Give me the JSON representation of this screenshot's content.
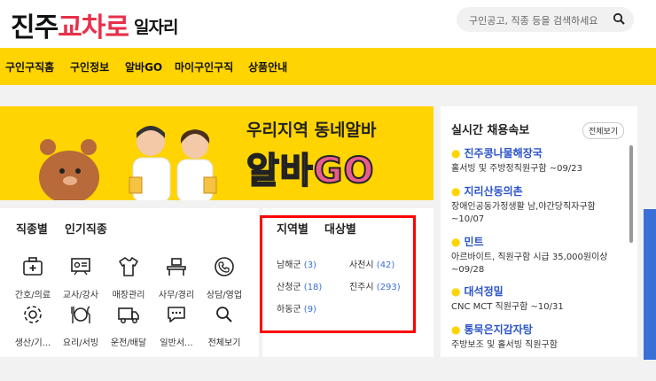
{
  "header": {
    "logo_part1": "진주",
    "logo_part2": "교차로",
    "logo_part3": "일자리",
    "search_placeholder": "구인공고, 직종 등을 검색하세요",
    "search_icon": "search-icon"
  },
  "nav": {
    "items": [
      {
        "label": "구인구직홈",
        "active": true
      },
      {
        "label": "구인정보",
        "active": false
      },
      {
        "label": "알바GO",
        "active": false
      },
      {
        "label": "마이구인구직",
        "active": false
      },
      {
        "label": "상품안내",
        "active": false
      }
    ]
  },
  "banner": {
    "line1": "우리지역 동네알바",
    "line2_a": "알바",
    "line2_b": "GO"
  },
  "categories": {
    "tabs": [
      {
        "label": "직종별",
        "active": true
      },
      {
        "label": "인기직종",
        "active": false
      }
    ],
    "items": [
      {
        "label": "간호/의료",
        "icon": "medical-kit-icon"
      },
      {
        "label": "교사/강사",
        "icon": "teacher-board-icon"
      },
      {
        "label": "매장관리",
        "icon": "shirt-icon"
      },
      {
        "label": "사무/경리",
        "icon": "office-desk-icon"
      },
      {
        "label": "상담/영업",
        "icon": "phone-icon"
      },
      {
        "label": "생산/기...",
        "icon": "gear-icon"
      },
      {
        "label": "요리/서빙",
        "icon": "dish-icon"
      },
      {
        "label": "운전/배달",
        "icon": "truck-icon"
      },
      {
        "label": "일반서...",
        "icon": "chat-bubble-icon"
      },
      {
        "label": "전체보기",
        "icon": "search-icon"
      }
    ]
  },
  "regions": {
    "tabs": [
      {
        "label": "지역별",
        "active": true
      },
      {
        "label": "대상별",
        "active": false
      }
    ],
    "items": [
      {
        "name": "남해군",
        "count": "(3)"
      },
      {
        "name": "사천시",
        "count": "(42)"
      },
      {
        "name": "산청군",
        "count": "(18)"
      },
      {
        "name": "진주시",
        "count": "(293)"
      },
      {
        "name": "하동군",
        "count": "(9)"
      }
    ]
  },
  "live": {
    "title": "실시간 채용속보",
    "view_all": "전체보기",
    "posts": [
      {
        "name": "진주콩나물해장국",
        "desc": "홀서빙 및 주방정직원구함 ~09/23"
      },
      {
        "name": "지리산동의촌",
        "desc": "장애인공동가정생활 남,야간당직자구함 ~10/07"
      },
      {
        "name": "민트",
        "desc": "아르바이트, 직원구함 시급 35,000원이상 ~09/28"
      },
      {
        "name": "대석정밀",
        "desc": "CNC MCT 직원구함 ~10/31"
      },
      {
        "name": "통묵은지감자탕",
        "desc": "주방보조 및 홀서빙 직원구함"
      }
    ]
  },
  "colors": {
    "brand_yellow": "#ffd400",
    "brand_red": "#e8304a",
    "link_blue": "#2b53c9",
    "count_blue": "#3a6fd8",
    "highlight_box": "#ff0000"
  }
}
